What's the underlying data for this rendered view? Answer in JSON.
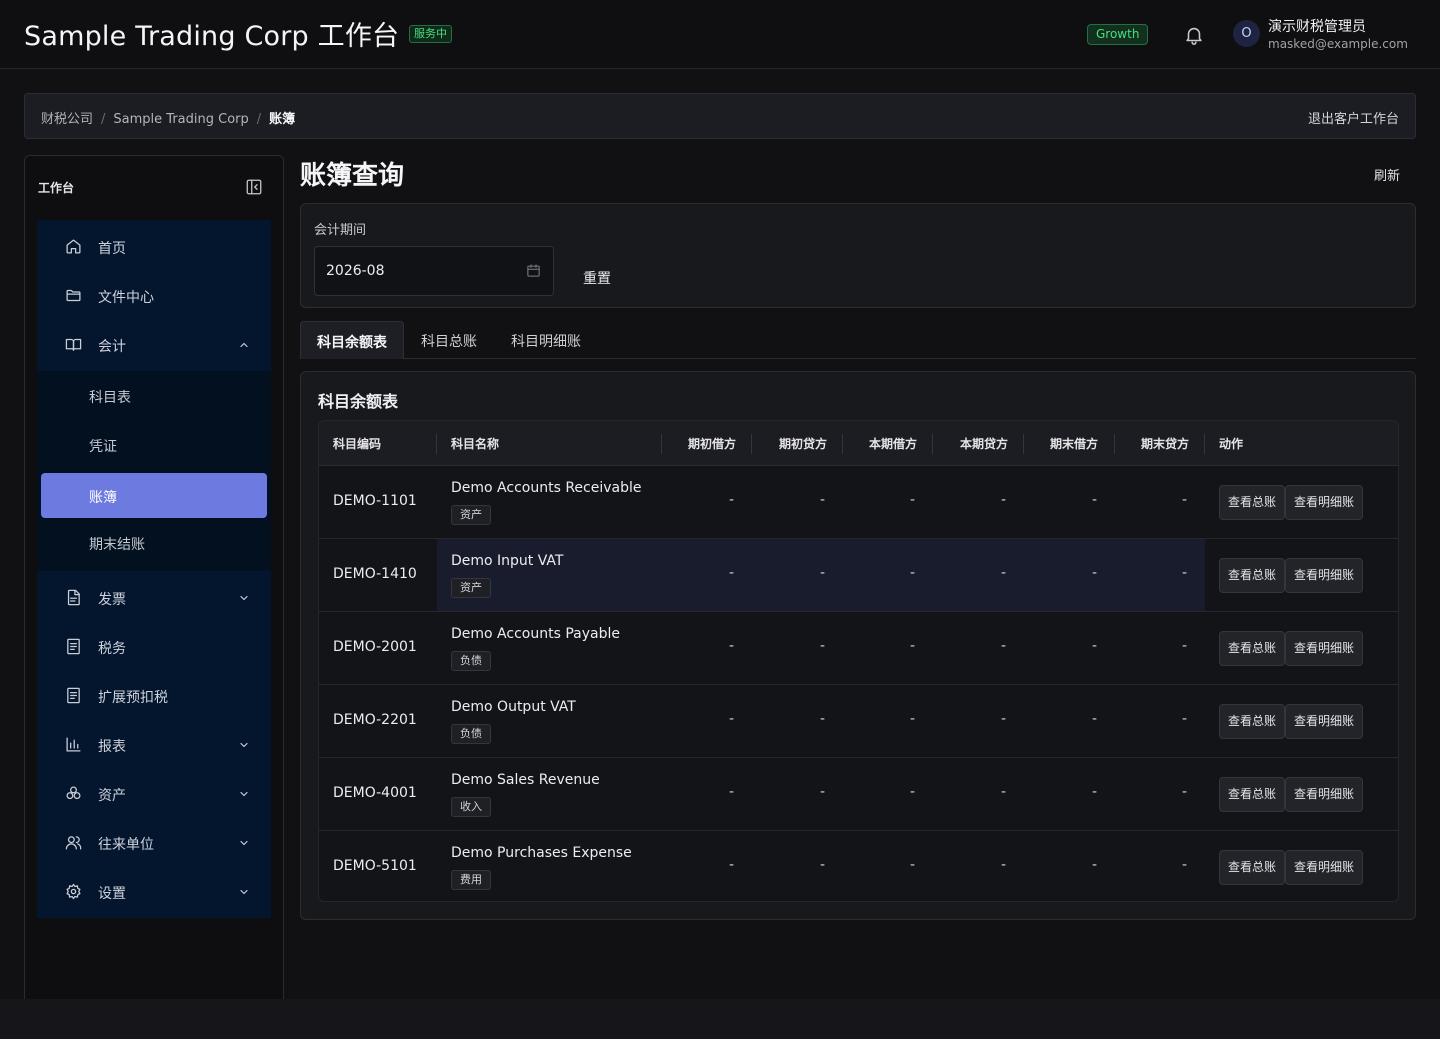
{
  "header": {
    "title": "Sample Trading Corp 工作台",
    "status_badge": "服务中",
    "plan_badge": "Growth",
    "user": {
      "avatar_initial": "O",
      "name": "演示财税管理员",
      "email": "masked@example.com"
    }
  },
  "breadcrumb": {
    "items": [
      "财税公司",
      "Sample Trading Corp",
      "账簿"
    ],
    "separator": "/",
    "exit_label": "退出客户工作台"
  },
  "sidebar": {
    "title": "工作台",
    "items": [
      {
        "label": "首页",
        "icon": "home-icon"
      },
      {
        "label": "文件中心",
        "icon": "folder-icon"
      },
      {
        "label": "会计",
        "icon": "book-icon",
        "expanded": true
      },
      {
        "label": "发票",
        "icon": "file-icon"
      },
      {
        "label": "税务",
        "icon": "receipt-icon"
      },
      {
        "label": "扩展预扣税",
        "icon": "receipt-icon"
      },
      {
        "label": "报表",
        "icon": "bar-chart-icon"
      },
      {
        "label": "资产",
        "icon": "boxes-icon"
      },
      {
        "label": "往来单位",
        "icon": "users-icon"
      },
      {
        "label": "设置",
        "icon": "gear-icon"
      }
    ],
    "accounting_sub": [
      "科目表",
      "凭证",
      "账簿",
      "期末结账"
    ],
    "active_sub": "账簿"
  },
  "main": {
    "title": "账簿查询",
    "refresh_label": "刷新",
    "filter": {
      "label": "会计期间",
      "period_value": "2026-08",
      "reset_label": "重置"
    },
    "tabs": [
      "科目余额表",
      "科目总账",
      "科目明细账"
    ],
    "active_tab": "科目余额表"
  },
  "table": {
    "title": "科目余额表",
    "columns": [
      "科目编码",
      "科目名称",
      "期初借方",
      "期初贷方",
      "本期借方",
      "本期贷方",
      "期末借方",
      "期末贷方",
      "动作"
    ],
    "rows": [
      {
        "code": "DEMO-1101",
        "name": "Demo Accounts Receivable",
        "type": "资产",
        "values": [
          "-",
          "-",
          "-",
          "-",
          "-",
          "-"
        ]
      },
      {
        "code": "DEMO-1410",
        "name": "Demo Input VAT",
        "type": "资产",
        "values": [
          "-",
          "-",
          "-",
          "-",
          "-",
          "-"
        ]
      },
      {
        "code": "DEMO-2001",
        "name": "Demo Accounts Payable",
        "type": "负债",
        "values": [
          "-",
          "-",
          "-",
          "-",
          "-",
          "-"
        ]
      },
      {
        "code": "DEMO-2201",
        "name": "Demo Output VAT",
        "type": "负债",
        "values": [
          "-",
          "-",
          "-",
          "-",
          "-",
          "-"
        ]
      },
      {
        "code": "DEMO-4001",
        "name": "Demo Sales Revenue",
        "type": "收入",
        "values": [
          "-",
          "-",
          "-",
          "-",
          "-",
          "-"
        ]
      },
      {
        "code": "DEMO-5101",
        "name": "Demo Purchases Expense",
        "type": "费用",
        "values": [
          "-",
          "-",
          "-",
          "-",
          "-",
          "-"
        ]
      }
    ],
    "actions": [
      "查看总账",
      "查看明细账"
    ]
  },
  "colors": {
    "accent": "#6d7be0",
    "success": "#4ade80",
    "nav_bg": "#04162d"
  }
}
